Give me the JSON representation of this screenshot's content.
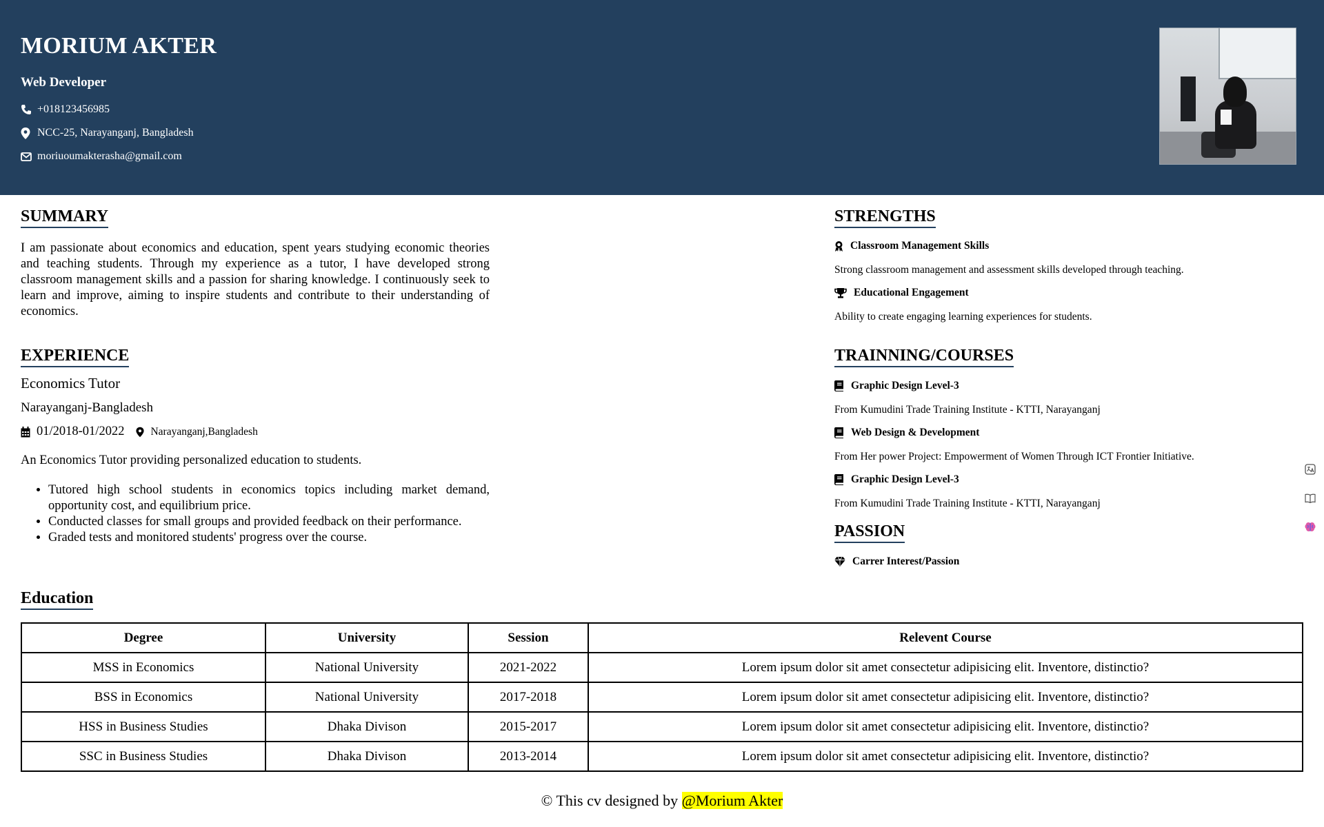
{
  "header": {
    "name": "MORIUM AKTER",
    "role": "Web Developer",
    "phone": "+018123456985",
    "address": "NCC-25, Narayanganj, Bangladesh",
    "email": "moriuoumakterasha@gmail.com",
    "photo_icon": "profile-photo"
  },
  "summary": {
    "title": "SUMMARY",
    "text": "I am passionate about economics and education, spent years studying economic theories and teaching students. Through my experience as a tutor, I have developed strong classroom management skills and a passion for sharing knowledge. I continuously seek to learn and improve, aiming to inspire students and contribute to their understanding of economics."
  },
  "experience": {
    "title": "EXPERIENCE",
    "job_title": "Economics Tutor",
    "location_line": "Narayanganj-Bangladesh",
    "dates": "01/2018-01/2022",
    "place": "Narayanganj,Bangladesh",
    "description": "An Economics Tutor providing personalized education to students.",
    "bullets": [
      "Tutored high school students in economics topics including market demand, opportunity cost, and equilibrium price.",
      "Conducted classes for small groups and provided feedback on their performance.",
      "Graded tests and monitored students' progress over the course."
    ]
  },
  "strengths": {
    "title": "STRENGTHS",
    "items": [
      {
        "icon": "award-icon",
        "title": "Classroom Management Skills",
        "text": "Strong classroom management and assessment skills developed through teaching."
      },
      {
        "icon": "trophy-icon",
        "title": "Educational Engagement",
        "text": "Ability to create engaging learning experiences for students."
      }
    ]
  },
  "training": {
    "title": "TRAINNING/COURSES",
    "items": [
      {
        "icon": "book-icon",
        "title": "Graphic Design Level-3",
        "text": "From Kumudini Trade Training Institute - KTTI, Narayanganj"
      },
      {
        "icon": "book-icon",
        "title": "Web Design & Development",
        "text": "From Her power Project: Empowerment of Women Through ICT Frontier Initiative."
      },
      {
        "icon": "book-icon",
        "title": "Graphic Design Level-3",
        "text": "From Kumudini Trade Training Institute - KTTI, Narayanganj"
      }
    ]
  },
  "passion": {
    "title": "PASSION",
    "item": "Carrer Interest/Passion",
    "icon": "gem-icon"
  },
  "education": {
    "title": "Education",
    "headers": [
      "Degree",
      "University",
      "Session",
      "Relevent Course"
    ],
    "rows": [
      [
        "MSS in Economics",
        "National University",
        "2021-2022",
        "Lorem ipsum dolor sit amet consectetur adipisicing elit. Inventore, distinctio?"
      ],
      [
        "BSS in Economics",
        "National University",
        "2017-2018",
        "Lorem ipsum dolor sit amet consectetur adipisicing elit. Inventore, distinctio?"
      ],
      [
        "HSS in Business Studies",
        "Dhaka Divison",
        "2015-2017",
        "Lorem ipsum dolor sit amet consectetur adipisicing elit. Inventore, distinctio?"
      ],
      [
        "SSC in Business Studies",
        "Dhaka Divison",
        "2013-2014",
        "Lorem ipsum dolor sit amet consectetur adipisicing elit. Inventore, distinctio?"
      ]
    ]
  },
  "footer": {
    "prefix": "© This cv designed by ",
    "author": "@Morium Akter"
  },
  "colors": {
    "header_bg": "#23405e",
    "highlight": "#ffff00",
    "text": "#000000"
  }
}
